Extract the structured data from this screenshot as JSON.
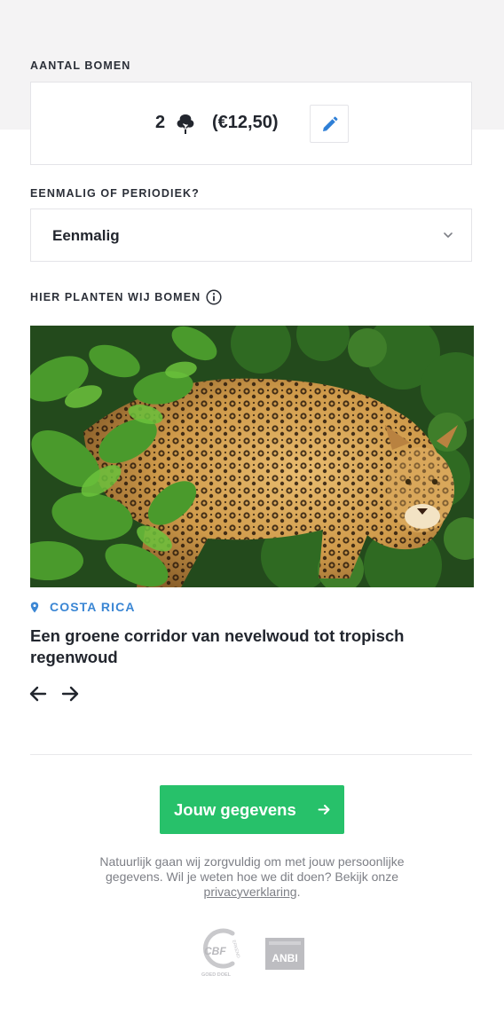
{
  "trees": {
    "section_label": "AANTAL BOMEN",
    "count": "2",
    "price": "(€12,50)"
  },
  "frequency": {
    "section_label": "EENMALIG OF PERIODIEK?",
    "selected": "Eenmalig"
  },
  "planting": {
    "section_label": "HIER PLANTEN WIJ BOMEN",
    "location": "COSTA RICA",
    "project_title": "Een groene corridor van nevelwoud tot tropisch regenwoud"
  },
  "cta": {
    "label": "Jouw gegevens"
  },
  "privacy": {
    "text": "Natuurlijk gaan wij zorgvuldig om met jouw persoonlijke gegevens. Wil je weten hoe we dit doen? Bekijk onze ",
    "link": "privacyverklaring",
    "suffix": "."
  },
  "logos": {
    "cbf_mark": "CBF",
    "cbf_side": "ERKEND",
    "cbf_caption": "GOED DOEL",
    "anbi": "ANBI"
  },
  "colors": {
    "accent_blue": "#3a86d4",
    "cta_green": "#27c16a",
    "top_band": "#f4f3f4"
  },
  "icons": [
    "tree-icon",
    "pencil-icon",
    "chevron-down-icon",
    "info-icon",
    "location-pin-icon",
    "arrow-left-icon",
    "arrow-right-icon",
    "arrow-right-icon"
  ]
}
